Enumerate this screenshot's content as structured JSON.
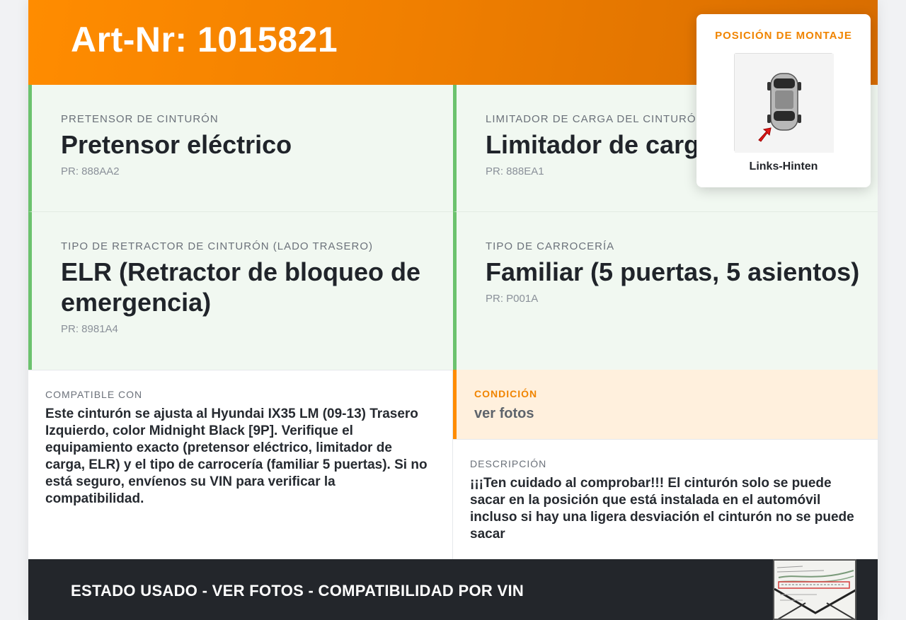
{
  "header": {
    "title": "Art-Nr: 1015821"
  },
  "cards": [
    {
      "label": "PRETENSOR DE CINTURÓN",
      "value": "Pretensor eléctrico",
      "pr": "PR: 888AA2"
    },
    {
      "label": "LIMITADOR DE CARGA DEL CINTURÓN",
      "value": "Limitador de carga",
      "pr": "PR: 888EA1"
    },
    {
      "label": "TIPO DE RETRACTOR DE CINTURÓN (LADO TRASERO)",
      "value": "ELR (Retractor de bloqueo de emergencia)",
      "pr": "PR: 8981A4"
    },
    {
      "label": "TIPO DE CARROCERÍA",
      "value": "Familiar (5 puertas, 5 asientos)",
      "pr": "PR: P001A"
    }
  ],
  "compatible": {
    "label": "COMPATIBLE CON",
    "text": "Este cinturón se ajusta al Hyundai IX35 LM (09-13) Trasero Izquierdo, color Midnight Black [9P]. Verifique el equipamiento exacto (pretensor eléctrico, limitador de carga, ELR) y el tipo de carrocería (familiar 5 puertas). Si no está seguro, envíenos su VIN para verificar la compatibilidad."
  },
  "condition": {
    "label": "CONDICIÓN",
    "value": "ver fotos"
  },
  "description": {
    "label": "DESCRIPCIÓN",
    "text": "¡¡¡Ten cuidado al comprobar!!! El cinturón solo se puede sacar en la posición que está instalada en el automóvil incluso si hay una ligera desviación el cinturón no se puede sacar"
  },
  "footer": {
    "text": "ESTADO USADO - VER FOTOS - COMPATIBILIDAD POR VIN"
  },
  "mounting": {
    "title": "POSICIÓN DE MONTAJE",
    "caption": "Links-Hinten",
    "icon": "car-top-view-icon",
    "marker_color": "#e01818"
  },
  "colors": {
    "accent": "#ff8c00",
    "card_border": "#6cc26e",
    "card_bg": "#f1f8f1",
    "footer_bg": "#23262b"
  }
}
